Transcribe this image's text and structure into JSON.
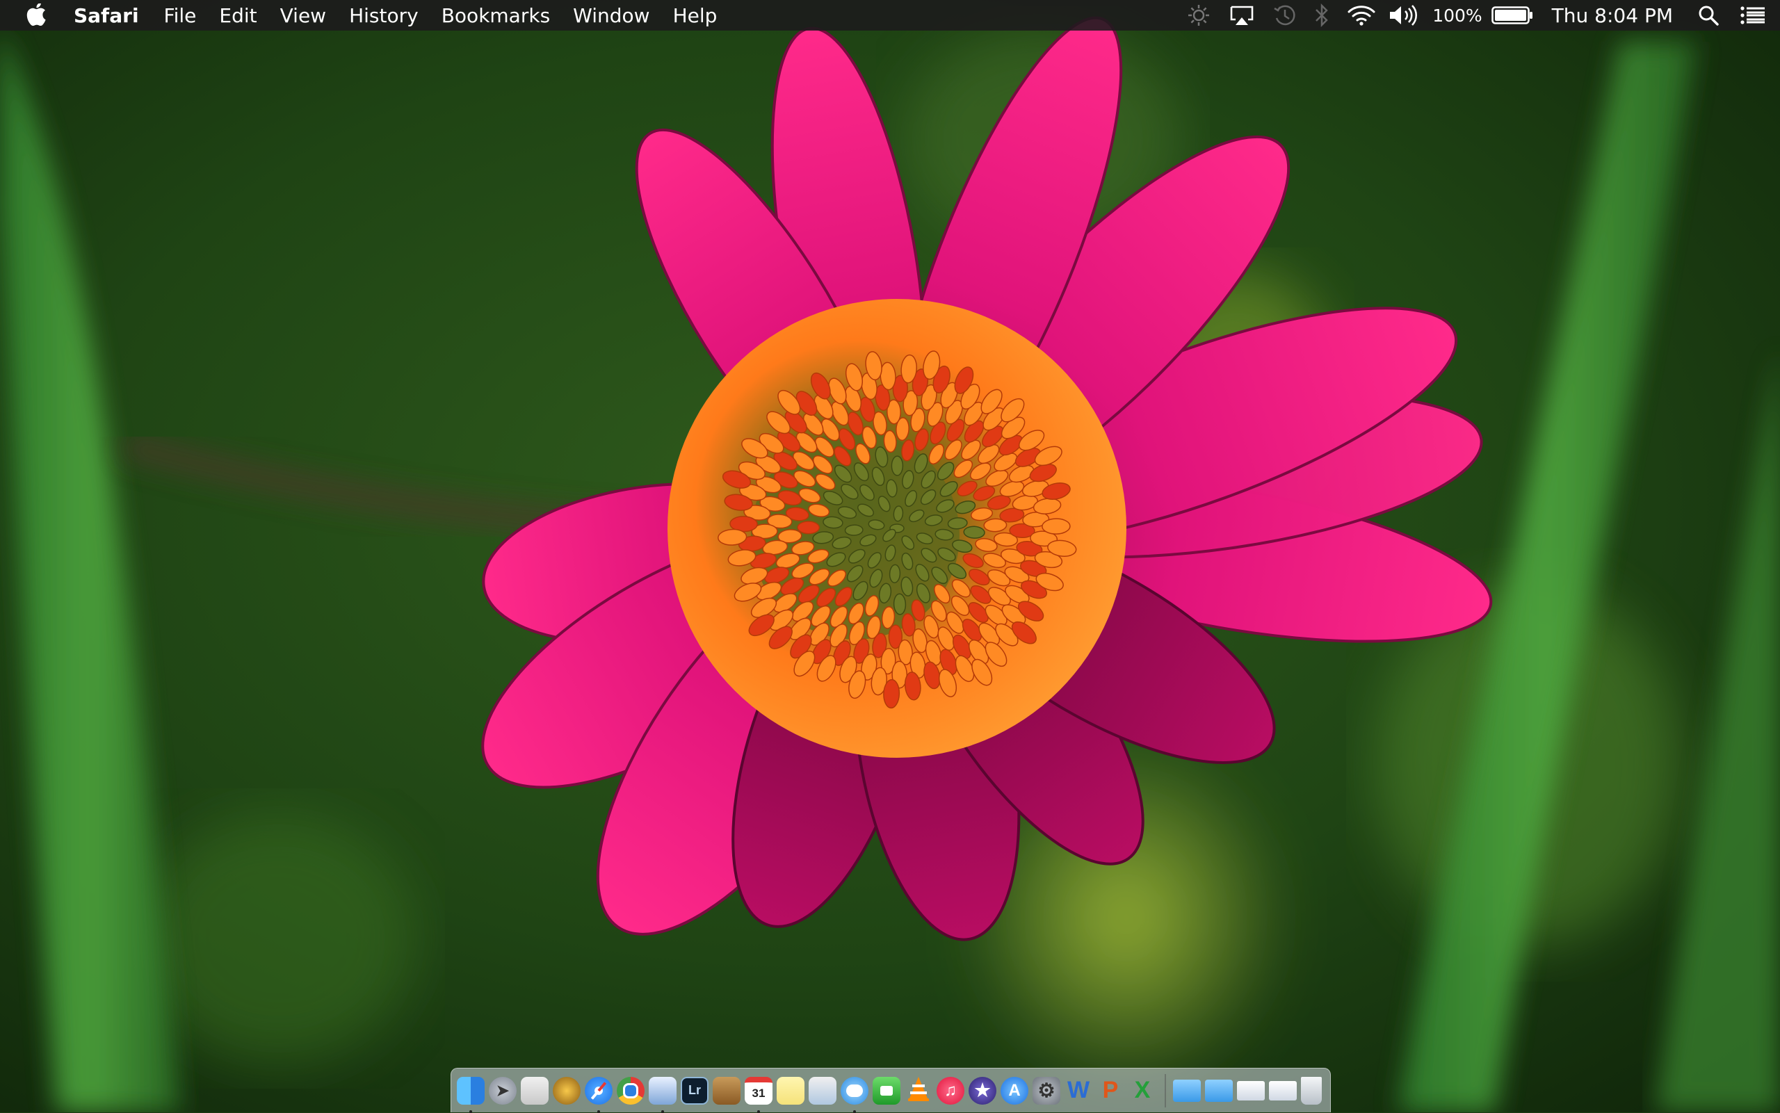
{
  "menubar": {
    "app_name": "Safari",
    "menus": [
      "File",
      "Edit",
      "View",
      "History",
      "Bookmarks",
      "Window",
      "Help"
    ],
    "battery_percent": "100%",
    "clock": "Thu 8:04 PM"
  },
  "dock": {
    "app_items": [
      {
        "name": "finder",
        "icon": "finder-icon",
        "running": true
      },
      {
        "name": "launchpad",
        "icon": "rocket-icon",
        "running": false
      },
      {
        "name": "app-3",
        "icon": "app-icon",
        "running": false
      },
      {
        "name": "app-4",
        "icon": "pineapple-icon",
        "running": false
      },
      {
        "name": "safari",
        "icon": "compass-icon",
        "running": true
      },
      {
        "name": "chrome",
        "icon": "chrome-icon",
        "running": false
      },
      {
        "name": "preview",
        "icon": "preview-icon",
        "running": true
      },
      {
        "name": "lightroom",
        "icon": "lightroom-icon",
        "label": "Lr",
        "running": false
      },
      {
        "name": "notebook",
        "icon": "notebook-icon",
        "running": false
      },
      {
        "name": "calendar",
        "icon": "calendar-icon",
        "label": "31",
        "running": true
      },
      {
        "name": "notes",
        "icon": "notes-icon",
        "running": false
      },
      {
        "name": "app-12",
        "icon": "app-icon",
        "running": false
      },
      {
        "name": "messages",
        "icon": "speech-bubble-icon",
        "running": true
      },
      {
        "name": "facetime",
        "icon": "facetime-icon",
        "running": false
      },
      {
        "name": "vlc",
        "icon": "cone-icon",
        "running": false
      },
      {
        "name": "itunes",
        "icon": "music-note-icon",
        "running": false
      },
      {
        "name": "imovie",
        "icon": "star-icon",
        "running": false
      },
      {
        "name": "app-store",
        "icon": "app-store-icon",
        "running": false
      },
      {
        "name": "system-preferences",
        "icon": "gear-icon",
        "running": false
      },
      {
        "name": "word",
        "icon": "word-icon",
        "label": "W",
        "running": false
      },
      {
        "name": "powerpoint",
        "icon": "powerpoint-icon",
        "label": "P",
        "running": false
      },
      {
        "name": "excel",
        "icon": "excel-icon",
        "label": "X",
        "running": false
      }
    ],
    "folder_items": [
      {
        "name": "applications-folder",
        "icon": "folder-icon"
      },
      {
        "name": "downloads-folder",
        "icon": "folder-icon"
      },
      {
        "name": "stack-1",
        "icon": "stack-icon"
      },
      {
        "name": "stack-2",
        "icon": "stack-icon"
      },
      {
        "name": "trash",
        "icon": "trash-icon"
      }
    ]
  }
}
